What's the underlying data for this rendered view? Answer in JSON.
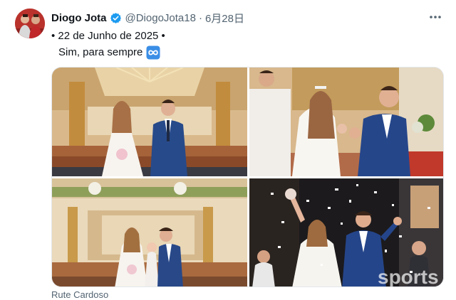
{
  "tweet": {
    "author_name": "Diogo Jota",
    "handle": "@DiogoJota18",
    "separator": "·",
    "date": "6月28日",
    "text_line1": "• 22 de Junho de 2025 •",
    "text_line2": "Sim, para sempre",
    "emoji": "infinity-icon",
    "more_icon": "more-icon",
    "verified_icon": "verified-badge-icon"
  },
  "media": {
    "photos": [
      {
        "name": "photo-altar-couple",
        "alt": "Couple standing at church altar"
      },
      {
        "name": "photo-ring-ceremony",
        "alt": "Couple showing ring at ceremony"
      },
      {
        "name": "photo-altar-with-child",
        "alt": "Couple with child at altar"
      },
      {
        "name": "photo-petal-exit",
        "alt": "Couple exiting church under petals"
      }
    ],
    "watermark": "sports"
  },
  "caption": "Rute Cardoso",
  "colors": {
    "verified": "#1d9bf0",
    "text": "#0f1419",
    "muted": "#536471",
    "emoji_blue": "#3a8ee6"
  }
}
